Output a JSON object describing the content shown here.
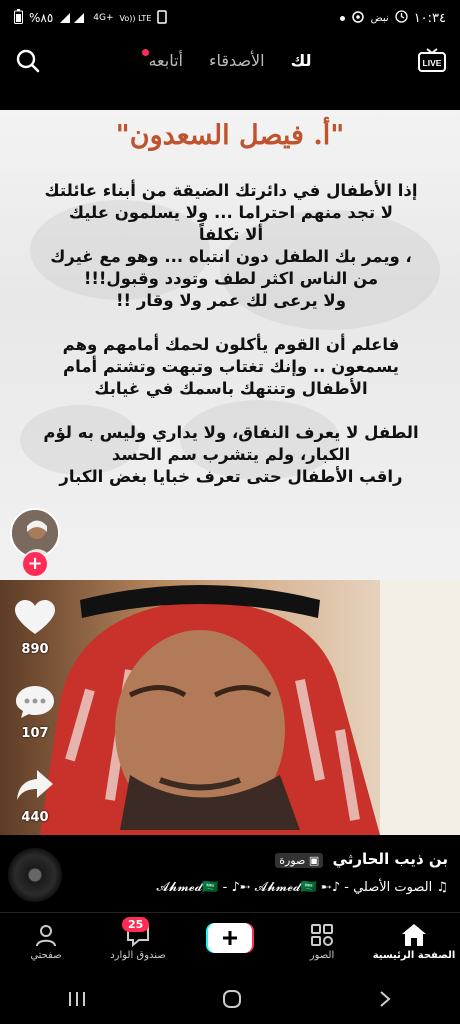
{
  "status_bar": {
    "battery": "%٨٥",
    "network_4g": "4G+",
    "network_volte": "Vo)) LTE",
    "time": "١٠:٣٤",
    "carrier_app": "نبض"
  },
  "top_nav": {
    "tab_following": "أتابعه",
    "tab_friends": "الأصدقاء",
    "tab_for_you": "لك",
    "live_label": "LIVE"
  },
  "post": {
    "author_title": "\"أ. فيصل السعدون\"",
    "paragraphs": [
      [
        "إذا الأطفال في دائرتك الضيقة من أبناء عائلتك",
        "لا تجد منهم احتراما ... ولا يسلمون عليك",
        "ألا تكلفاً",
        "، ويمر بك الطفل دون انتباه ... وهو مع غيرك",
        "من الناس اكثر لطف وتودد وقبول!!!",
        "ولا يرعى لك عمر ولا وقار !!"
      ],
      [
        "فاعلم أن القوم يأكلون لحمك أمامهم وهم",
        "يسمعون .. وإنك تغتاب وتبهت وتشتم أمام",
        "الأطفال وتنتهك باسمك في غيابك"
      ],
      [
        "الطفل لا يعرف النفاق، ولا يداري وليس به لؤم",
        "الكبار، ولم يتشرب سم الحسد",
        "راقب الأطفال حتى تعرف خبايا بغض الكبار"
      ]
    ]
  },
  "actions": {
    "likes": "890",
    "comments": "107",
    "shares": "440"
  },
  "info": {
    "username": "بن ذيب الحارثي",
    "photo_tag": "صورة",
    "sound": "♫ الصوت الأصلي - ♪➸ 𝓐𝓱𝓶𝓮𝓭🇸🇦 - ♪➸ 𝓐𝓱𝓶𝓮𝓭🇸🇦"
  },
  "bottom_nav": {
    "home": "الصفحة الرئيسية",
    "photos": "الصور",
    "inbox": "صندوق الوارد",
    "inbox_badge": "25",
    "profile": "صفحتي"
  },
  "colors": {
    "accent_red": "#ff2d55",
    "title_color": "#c0532e",
    "create_cyan": "#25f4ee"
  }
}
